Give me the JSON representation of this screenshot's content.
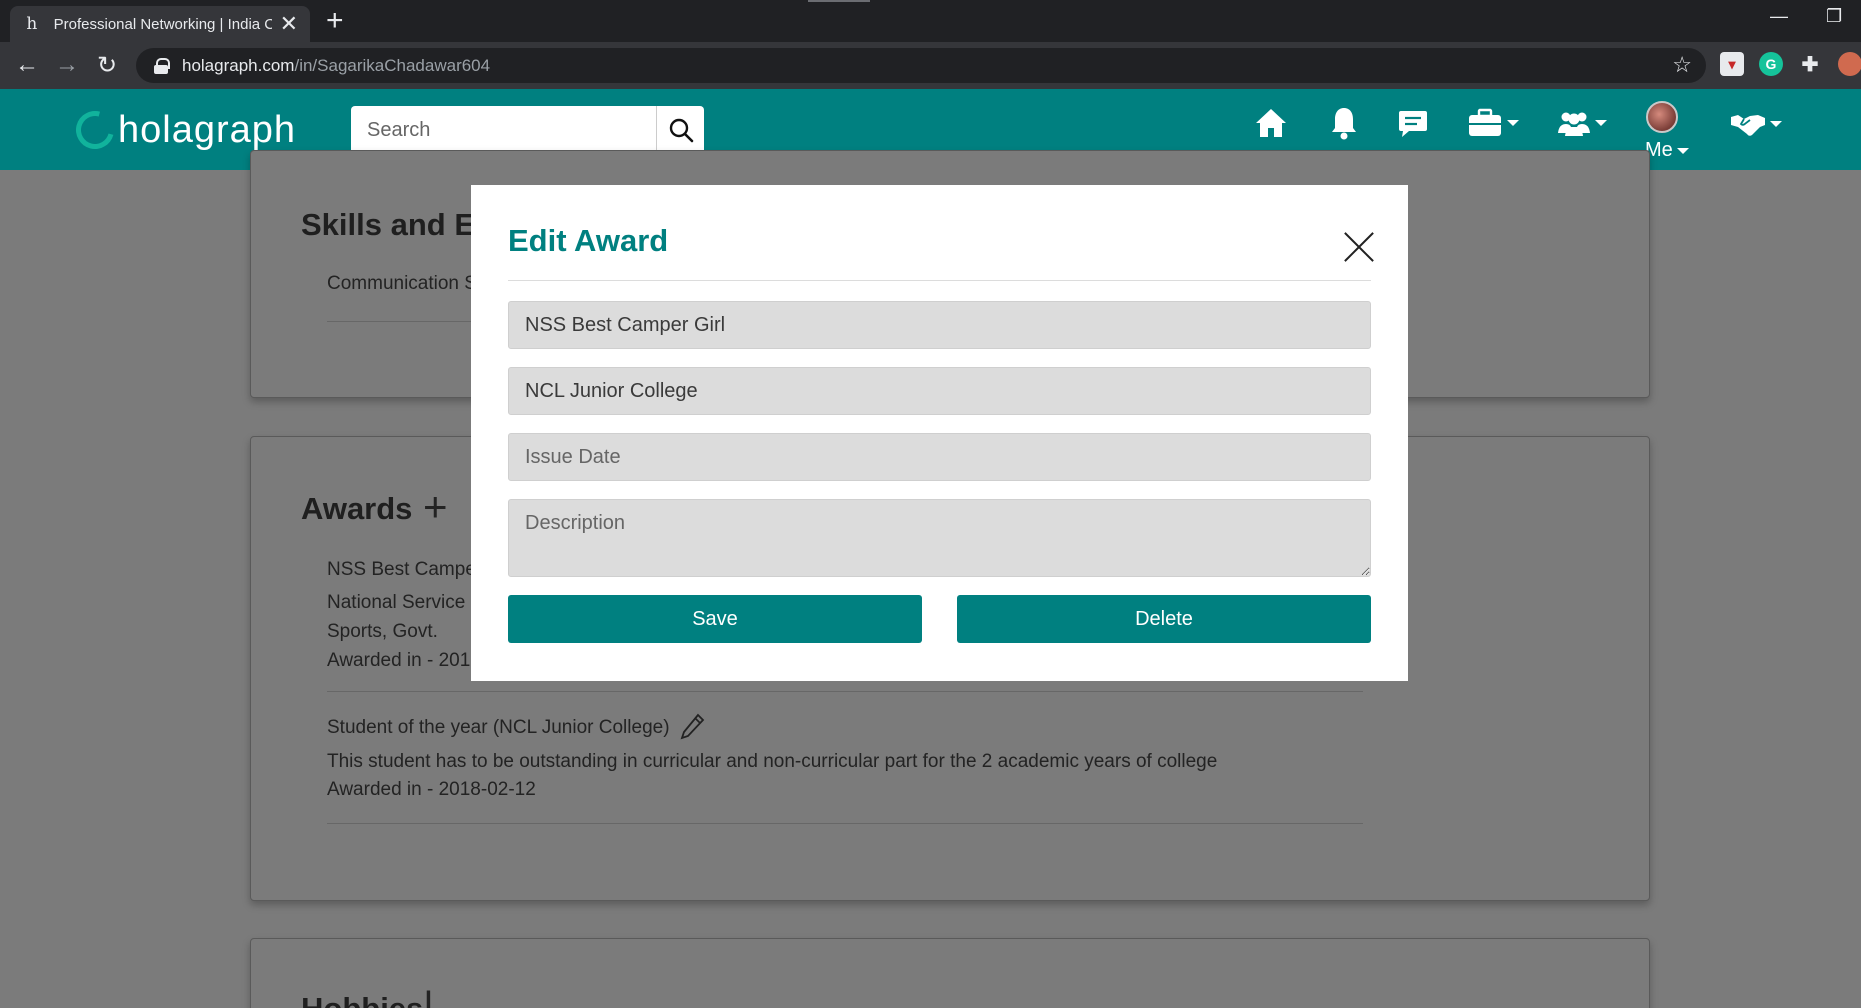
{
  "browser": {
    "tab_title": "Professional Networking | India C",
    "tab_favicon": "h",
    "url_host": "holagraph.com",
    "url_path": "/in/SagarikaChadawar604"
  },
  "header": {
    "logo": "holagraph",
    "search_placeholder": "Search",
    "me_label": "Me",
    "brand_color": "#008080",
    "icons": [
      "home-icon",
      "bell-icon",
      "chat-icon",
      "briefcase-icon",
      "people-icon",
      "handshake-icon"
    ]
  },
  "page": {
    "skills_title": "Skills and Er",
    "skills_item": "Communication S",
    "awards_title": "Awards",
    "award1": {
      "line1": "NSS Best Camper",
      "line2": "National Service S",
      "line3": "Sports, Govt.",
      "line4": "Awarded in - 201"
    },
    "award2": {
      "title": "Student of the year (NCL Junior College)",
      "description": "This student has to be outstanding in curricular and non-curricular part for the 2 academic years of college",
      "date": "Awarded in - 2018-02-12"
    },
    "hobbies_title": "Hobbies"
  },
  "modal": {
    "title": "Edit Award",
    "award_name": "NSS Best Camper Girl",
    "issuer": "NCL Junior College",
    "issue_date_placeholder": "Issue Date",
    "description_placeholder": "Description",
    "save_label": "Save",
    "delete_label": "Delete"
  }
}
